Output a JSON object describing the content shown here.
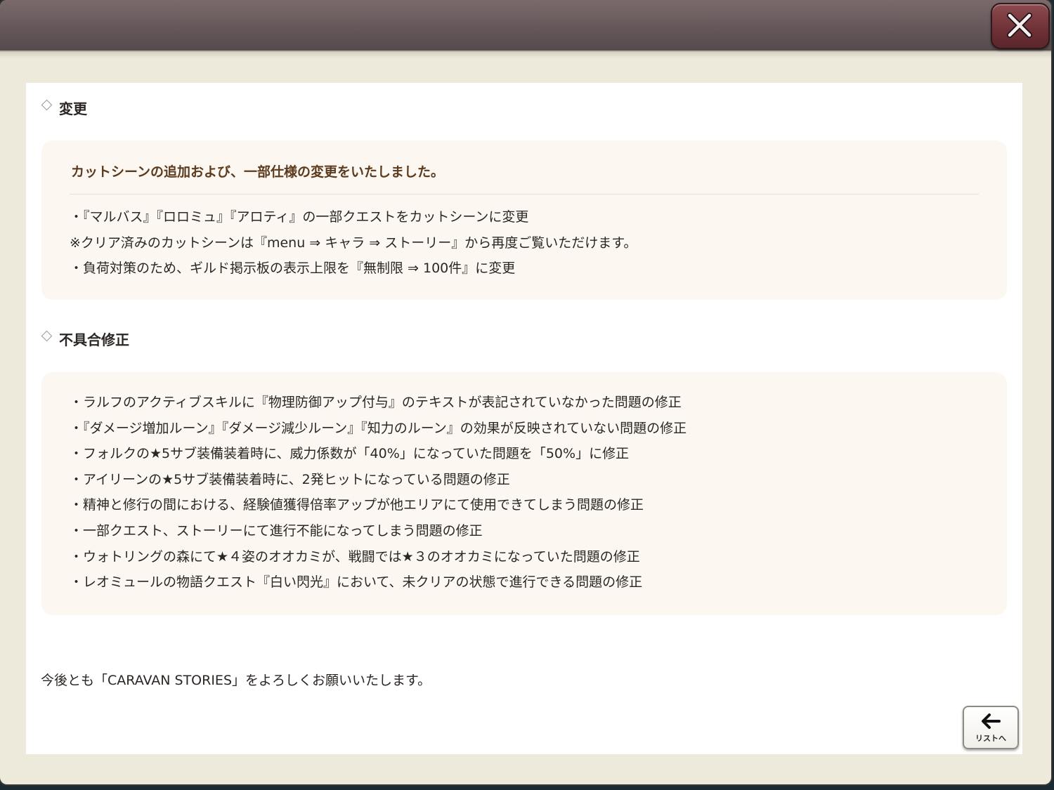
{
  "window": {
    "close_icon": "close-x-icon"
  },
  "changes": {
    "heading": "変更",
    "card_title": "カットシーンの追加および、一部仕様の変更をいたしました。",
    "items": [
      "・『マルバス』『ロロミュ』『アロティ』の一部クエストをカットシーンに変更",
      "※クリア済みのカットシーンは『menu ⇒ キャラ ⇒ ストーリー』から再度ご覧いただけます。",
      "・負荷対策のため、ギルド掲示板の表示上限を『無制限 ⇒ 100件』に変更"
    ]
  },
  "fixes": {
    "heading": "不具合修正",
    "items": [
      "・ラルフのアクティブスキルに『物理防御アップ付与』のテキストが表記されていなかった問題の修正",
      "・『ダメージ増加ルーン』『ダメージ減少ルーン』『知力のルーン』の効果が反映されていない問題の修正",
      "・フォルクの★5サブ装備装着時に、威力係数が「40%」になっていた問題を「50%」に修正",
      "・アイリーンの★5サブ装備装着時に、2発ヒットになっている問題の修正",
      "・精神と修行の間における、経験値獲得倍率アップが他エリアにて使用できてしまう問題の修正",
      "・一部クエスト、ストーリーにて進行不能になってしまう問題の修正",
      "・ウォトリングの森にて★４姿のオオカミが、戦闘では★３のオオカミになっていた問題の修正",
      "・レオミュールの物語クエスト『白い閃光』において、未クリアの状態で進行できる問題の修正"
    ]
  },
  "closing": "今後とも「CARAVAN STORIES」をよろしくお願いいたします。",
  "back_button": {
    "label": "リストへ",
    "icon": "arrow-left-icon"
  },
  "colors": {
    "titlebar": "#6b5c5e",
    "close_button": "#7a3a40",
    "card_title": "#5c3a1e",
    "card_background": "#fcf8f1"
  }
}
